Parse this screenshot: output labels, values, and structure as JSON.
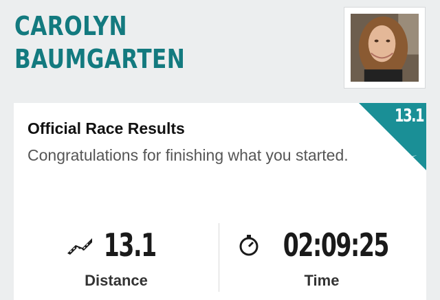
{
  "profile": {
    "first_name": "CAROLYN",
    "last_name": "BAUMGARTEN"
  },
  "card": {
    "title": "Official Race Results",
    "subtitle": "Congratulations for finishing what you started.",
    "badge": "13.1",
    "badge_color": "#1a8f96"
  },
  "stats": {
    "distance_value": "13.1",
    "distance_label": "Distance",
    "time_value": "02:09:25",
    "time_label": "Time"
  },
  "colors": {
    "accent": "#137a7f",
    "background": "#eceeef"
  }
}
